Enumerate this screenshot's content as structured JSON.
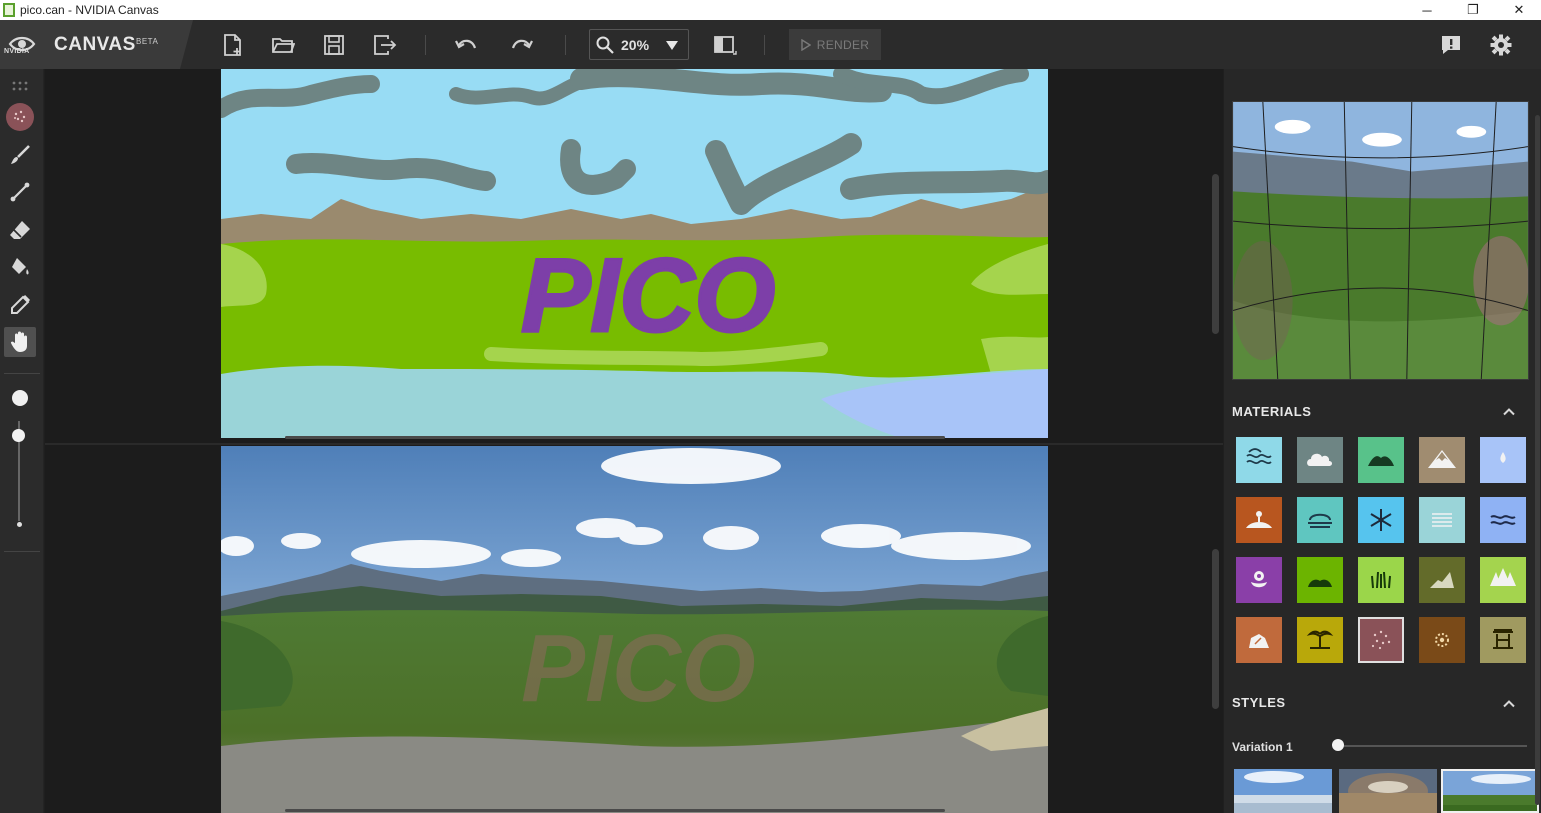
{
  "window": {
    "title": "pico.can - NVIDIA Canvas",
    "minimize": "─",
    "restore": "❐",
    "close": "✕"
  },
  "brand": {
    "company": "NVIDIA",
    "product": "CANVAS",
    "tag": "BETA"
  },
  "toolbar": {
    "zoom_value": "20%",
    "render_label": "RENDER"
  },
  "segmentation_text": "PICO",
  "right_panel": {
    "materials_title": "MATERIALS",
    "styles_title": "STYLES",
    "variation_label": "Variation 1",
    "variation_value": 0.0
  },
  "materials": [
    {
      "icon": "sea-icon",
      "color": "#8fd9e8"
    },
    {
      "icon": "cloud-icon",
      "color": "#6e8584"
    },
    {
      "icon": "hill-icon",
      "color": "#58c28a"
    },
    {
      "icon": "mountain-icon",
      "color": "#a08c70"
    },
    {
      "icon": "water-drop-icon",
      "color": "#a8c4f8"
    },
    {
      "icon": "sand-icon",
      "color": "#b8561f"
    },
    {
      "icon": "fog-icon",
      "color": "#5fc6c0"
    },
    {
      "icon": "snow-icon",
      "color": "#56c4ee"
    },
    {
      "icon": "river-icon",
      "color": "#9ad4d8"
    },
    {
      "icon": "lake-icon",
      "color": "#8fb2f4"
    },
    {
      "icon": "flower-icon",
      "color": "#8a3fa8"
    },
    {
      "icon": "bush-icon",
      "color": "#6cb400"
    },
    {
      "icon": "grass-icon",
      "color": "#9bd64a"
    },
    {
      "icon": "dirt-icon",
      "color": "#636b2a"
    },
    {
      "icon": "tree-icon",
      "color": "#a4d44e"
    },
    {
      "icon": "rock-icon",
      "color": "#c06a3c"
    },
    {
      "icon": "palm-icon",
      "color": "#b9a80a"
    },
    {
      "icon": "gravel-icon",
      "color": "#8a5258"
    },
    {
      "icon": "stone-icon",
      "color": "#7a4a18"
    },
    {
      "icon": "building-icon",
      "color": "#a09a60"
    }
  ],
  "styles": [
    {
      "name": "style-1"
    },
    {
      "name": "style-2"
    },
    {
      "name": "style-3"
    }
  ],
  "colors": {
    "accent_selected_material": "#8a5258",
    "sky": "#98dcf4",
    "ground": "#78b800"
  }
}
